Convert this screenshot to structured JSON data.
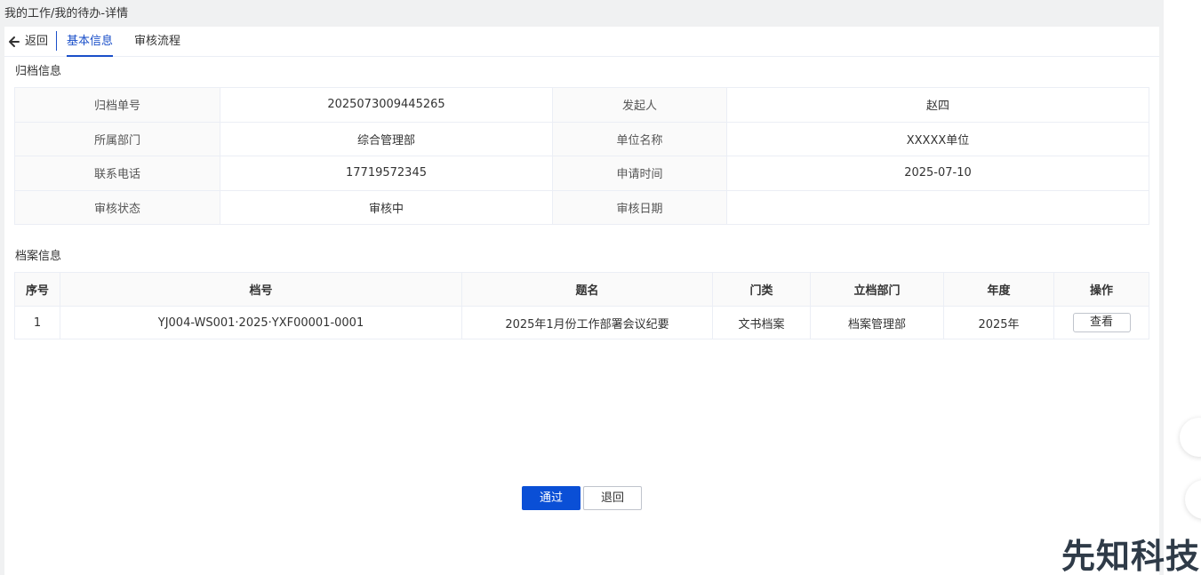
{
  "breadcrumb": "我的工作/我的待办-详情",
  "tabs": {
    "back_label": "返回",
    "basic_info": "基本信息",
    "audit_flow": "审核流程"
  },
  "archive_info": {
    "title": "归档信息",
    "rows": [
      {
        "l1": "归档单号",
        "v1": "2025073009445265",
        "l2": "发起人",
        "v2": "赵四"
      },
      {
        "l1": "所属部门",
        "v1": "综合管理部",
        "l2": "单位名称",
        "v2": "XXXXX单位"
      },
      {
        "l1": "联系电话",
        "v1": "17719572345",
        "l2": "申请时间",
        "v2": "2025-07-10"
      },
      {
        "l1": "审核状态",
        "v1": "审核中",
        "l2": "审核日期",
        "v2": ""
      }
    ]
  },
  "file_info": {
    "title": "档案信息",
    "columns": [
      "序号",
      "档号",
      "题名",
      "门类",
      "立档部门",
      "年度",
      "操作"
    ],
    "rows": [
      {
        "index": "1",
        "file_no": "YJ004-WS001·2025·YXF00001-0001",
        "title": "2025年1月份工作部署会议纪要",
        "category": "文书档案",
        "dept": "档案管理部",
        "year": "2025年",
        "action": "查看"
      }
    ]
  },
  "actions": {
    "pass": "通过",
    "return": "退回"
  },
  "watermark": "先知科技",
  "colors": {
    "primary": "#0a4fd6",
    "tab_active": "#1a4fc9",
    "border": "#ebeef5",
    "label_bg": "#fafafa"
  }
}
